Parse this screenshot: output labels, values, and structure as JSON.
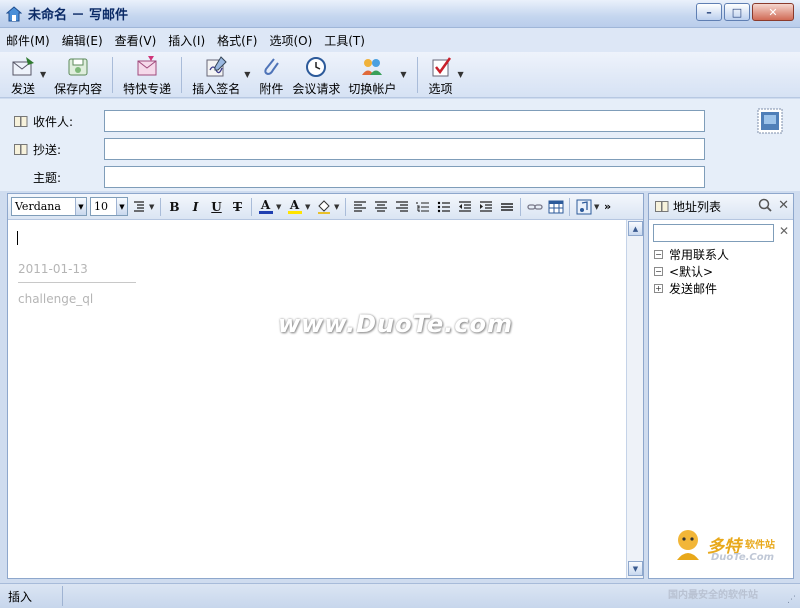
{
  "window": {
    "title": "未命名 － 写邮件",
    "controls": {
      "minimize": "–",
      "maximize": "□",
      "close": "✕"
    }
  },
  "menubar": {
    "items": [
      {
        "label": "邮件(M)"
      },
      {
        "label": "编辑(E)"
      },
      {
        "label": "查看(V)"
      },
      {
        "label": "插入(I)"
      },
      {
        "label": "格式(F)"
      },
      {
        "label": "选项(O)"
      },
      {
        "label": "工具(T)"
      }
    ]
  },
  "toolbar": {
    "send": "发送",
    "save": "保存内容",
    "express": "特快专递",
    "signature": "插入签名",
    "attachment": "附件",
    "meeting": "会议请求",
    "account": "切换帐户",
    "options": "选项",
    "more": "»"
  },
  "fields": {
    "to_label": "收件人:",
    "cc_label": "抄送:",
    "subject_label": "主题:",
    "to_value": "",
    "cc_value": "",
    "subject_value": ""
  },
  "format": {
    "font": "Verdana",
    "size": "10",
    "bold": "B",
    "italic": "I",
    "underline": "U",
    "strike": "T",
    "font_color": "A",
    "highlight": "A",
    "more": "»"
  },
  "editor": {
    "signature_date": "2011-01-13",
    "signature_name": "challenge_ql",
    "watermark": "www.DuoTe.com"
  },
  "address_panel": {
    "title": "地址列表",
    "search_value": "",
    "tree": [
      {
        "label": "常用联系人",
        "toggle": "−"
      },
      {
        "label": "<默认>",
        "toggle": "−"
      },
      {
        "label": "发送邮件",
        "toggle": "+"
      }
    ],
    "logo_main": "多特",
    "logo_sub": "软件站",
    "logo_url": "DuoTe.Com",
    "logo_tagline": "国内最安全的软件站"
  },
  "status": {
    "mode": "插入"
  },
  "colors": {
    "accent": "#0b2a66",
    "frame": "#cfdcef",
    "font_color_bar": "#1f3fb0",
    "highlight_bar": "#ffe400"
  }
}
